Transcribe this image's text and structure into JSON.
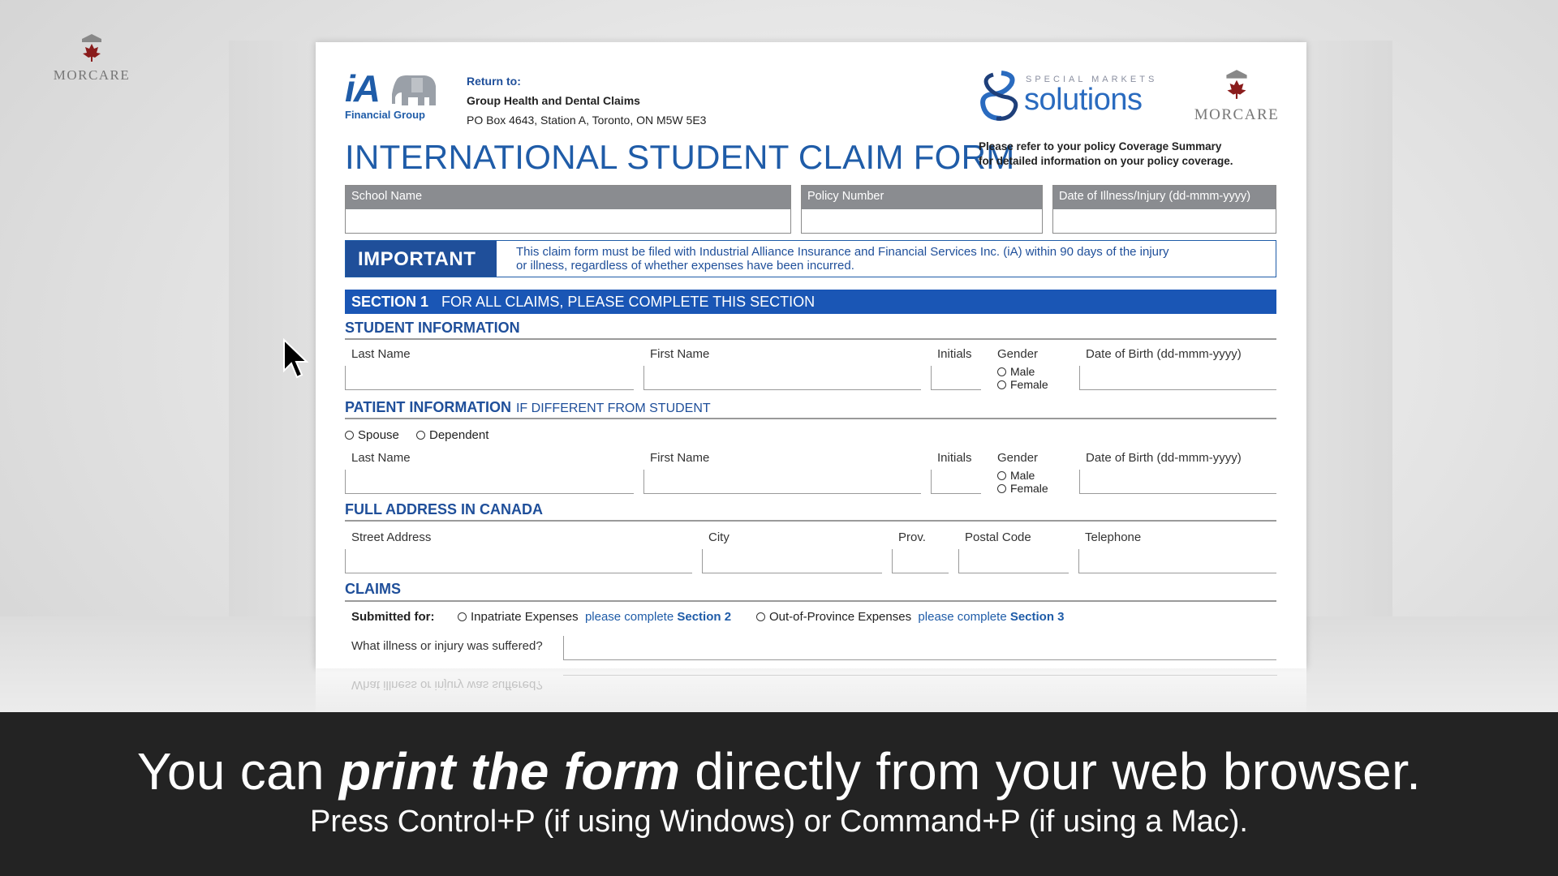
{
  "corner_logo": {
    "word_a": "MOR",
    "word_b": "CARE"
  },
  "form": {
    "ia_logo": {
      "mark": "iA",
      "sub": "Financial Group"
    },
    "return_to": {
      "label": "Return to:",
      "line1": "Group Health and Dental Claims",
      "line2": "PO Box 4643, Station A, Toronto, ON  M5W 5E3"
    },
    "sms_logo": {
      "special": "SPECIAL MARKETS",
      "solutions": "solutions"
    },
    "morcare_logo": {
      "word_a": "MOR",
      "word_b": "CARE"
    },
    "title": "INTERNATIONAL STUDENT CLAIM FORM",
    "coverage_note": {
      "line1": "Please refer to your policy Coverage Summary",
      "line2": "for detailed information on your policy coverage."
    },
    "header_fields": [
      "School Name",
      "Policy Number",
      "Date of Illness/Injury (dd-mmm-yyyy)"
    ],
    "important": {
      "tag": "IMPORTANT",
      "line1": "This claim form must be filed with Industrial Alliance Insurance and Financial Services Inc. (iA) within 90 days of the injury",
      "line2": "or illness, regardless of whether expenses have been incurred."
    },
    "section1": {
      "num": "SECTION 1",
      "label": "FOR ALL CLAIMS, PLEASE COMPLETE THIS SECTION"
    },
    "student_info": {
      "heading": "STUDENT INFORMATION",
      "last_name": "Last Name",
      "first_name": "First Name",
      "initials": "Initials",
      "gender": "Gender",
      "male": "Male",
      "female": "Female",
      "dob": "Date of Birth (dd-mmm-yyyy)"
    },
    "patient_info": {
      "heading": "PATIENT INFORMATION",
      "extra": "IF DIFFERENT FROM STUDENT",
      "spouse": "Spouse",
      "dependent": "Dependent",
      "last_name": "Last Name",
      "first_name": "First Name",
      "initials": "Initials",
      "gender": "Gender",
      "male": "Male",
      "female": "Female",
      "dob": "Date of Birth (dd-mmm-yyyy)"
    },
    "address": {
      "heading": "FULL ADDRESS IN CANADA",
      "street": "Street Address",
      "city": "City",
      "prov": "Prov.",
      "postal": "Postal Code",
      "telephone": "Telephone"
    },
    "claims": {
      "heading": "CLAIMS",
      "submitted_for": "Submitted for:",
      "inpatriate": "Inpatriate Expenses",
      "please1": "please complete",
      "sec2": "Section 2",
      "oop": "Out-of-Province Expenses",
      "please2": "please complete",
      "sec3": "Section 3",
      "illness_q": "What illness or injury was suffered?"
    }
  },
  "caption": {
    "line1_pre": "You can ",
    "line1_em": "print the form",
    "line1_post": " directly from your web browser.",
    "line2": "Press Control+P (if using Windows) or Command+P (if using a Mac)."
  },
  "colors": {
    "brand_blue": "#1f5ca8",
    "section_blue": "#1a56b5",
    "morcare_red": "#8a1c1c",
    "caption_bg": "#232323"
  }
}
